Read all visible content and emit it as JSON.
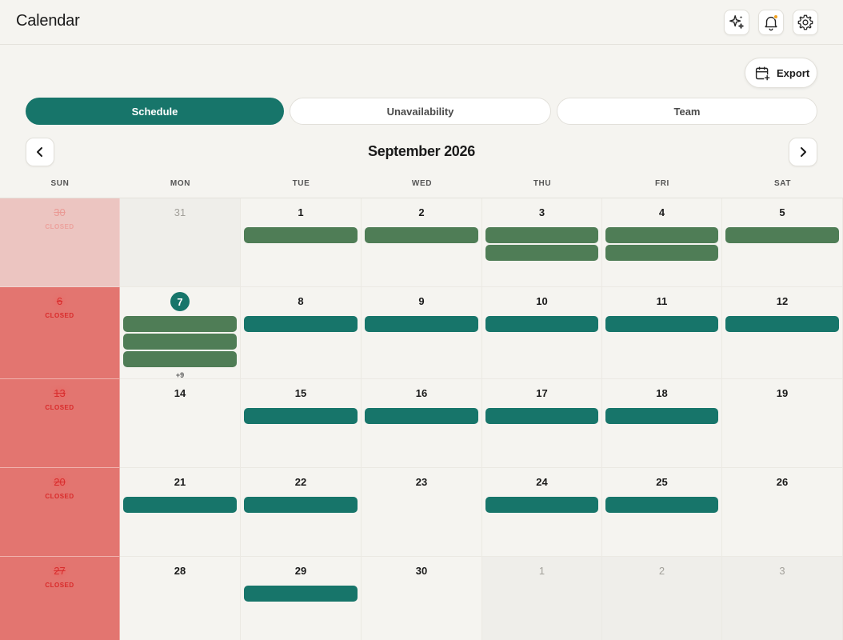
{
  "app": {
    "title": "Calendar"
  },
  "header_icons": [
    "sparkles-icon",
    "bell-icon",
    "gear-icon"
  ],
  "toolbar": {
    "export_label": "Export"
  },
  "tabs": [
    {
      "label": "Schedule",
      "active": true
    },
    {
      "label": "Unavailability",
      "active": false
    },
    {
      "label": "Team",
      "active": false
    }
  ],
  "calendar": {
    "month_label": "September 2026",
    "weekdays": [
      "SUN",
      "MON",
      "TUE",
      "WED",
      "THU",
      "FRI",
      "SAT"
    ],
    "closed_label": "CLOSED",
    "today": 7,
    "weeks": [
      [
        {
          "day": "30",
          "state": "closed-faded",
          "events": []
        },
        {
          "day": "31",
          "state": "out",
          "events": []
        },
        {
          "day": "1",
          "state": "normal",
          "events": [
            "green"
          ]
        },
        {
          "day": "2",
          "state": "normal",
          "events": [
            "green"
          ]
        },
        {
          "day": "3",
          "state": "normal",
          "events": [
            "green",
            "green"
          ]
        },
        {
          "day": "4",
          "state": "normal",
          "events": [
            "green",
            "green"
          ]
        },
        {
          "day": "5",
          "state": "normal",
          "events": [
            "green"
          ]
        }
      ],
      [
        {
          "day": "6",
          "state": "closed",
          "events": []
        },
        {
          "day": "7",
          "state": "today",
          "events": [
            "green",
            "green",
            "green"
          ],
          "more": "+9"
        },
        {
          "day": "8",
          "state": "normal",
          "events": [
            "teal"
          ]
        },
        {
          "day": "9",
          "state": "normal",
          "events": [
            "teal"
          ]
        },
        {
          "day": "10",
          "state": "normal",
          "events": [
            "teal"
          ]
        },
        {
          "day": "11",
          "state": "normal",
          "events": [
            "teal"
          ]
        },
        {
          "day": "12",
          "state": "normal",
          "events": [
            "teal"
          ]
        }
      ],
      [
        {
          "day": "13",
          "state": "closed",
          "events": []
        },
        {
          "day": "14",
          "state": "normal",
          "events": []
        },
        {
          "day": "15",
          "state": "normal",
          "events": [
            "teal"
          ]
        },
        {
          "day": "16",
          "state": "normal",
          "events": [
            "teal"
          ]
        },
        {
          "day": "17",
          "state": "normal",
          "events": [
            "teal"
          ]
        },
        {
          "day": "18",
          "state": "normal",
          "events": [
            "teal"
          ]
        },
        {
          "day": "19",
          "state": "normal",
          "events": []
        }
      ],
      [
        {
          "day": "20",
          "state": "closed",
          "events": []
        },
        {
          "day": "21",
          "state": "normal",
          "events": [
            "teal"
          ]
        },
        {
          "day": "22",
          "state": "normal",
          "events": [
            "teal"
          ]
        },
        {
          "day": "23",
          "state": "normal",
          "events": []
        },
        {
          "day": "24",
          "state": "normal",
          "events": [
            "teal"
          ]
        },
        {
          "day": "25",
          "state": "normal",
          "events": [
            "teal"
          ]
        },
        {
          "day": "26",
          "state": "normal",
          "events": []
        }
      ],
      [
        {
          "day": "27",
          "state": "closed",
          "events": []
        },
        {
          "day": "28",
          "state": "normal",
          "events": []
        },
        {
          "day": "29",
          "state": "normal",
          "events": [
            "teal"
          ]
        },
        {
          "day": "30",
          "state": "normal",
          "events": []
        },
        {
          "day": "1",
          "state": "out",
          "events": []
        },
        {
          "day": "2",
          "state": "out",
          "events": []
        },
        {
          "day": "3",
          "state": "out",
          "events": []
        }
      ]
    ]
  },
  "colors": {
    "accent": "#17756a",
    "event_green": "#4f7d56",
    "event_teal": "#17756a",
    "closed_bg": "#e37570",
    "closed_text": "#d92a2a",
    "notification_dot": "#f2a11e"
  }
}
